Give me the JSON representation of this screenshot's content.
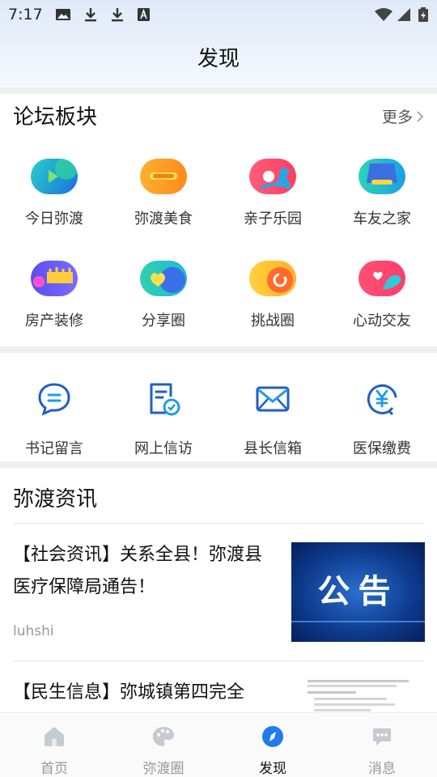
{
  "status": {
    "time": "7:17"
  },
  "header": {
    "title": "发现"
  },
  "forum": {
    "title": "论坛板块",
    "more": "更多",
    "items": [
      {
        "label": "今日弥渡",
        "icon": "play-video-icon"
      },
      {
        "label": "弥渡美食",
        "icon": "food-icon"
      },
      {
        "label": "亲子乐园",
        "icon": "rocking-horse-icon"
      },
      {
        "label": "车友之家",
        "icon": "car-icon"
      },
      {
        "label": "房产装修",
        "icon": "paint-brush-icon"
      },
      {
        "label": "分享圈",
        "icon": "heart-share-icon"
      },
      {
        "label": "挑战圈",
        "icon": "challenge-icon"
      },
      {
        "label": "心动交友",
        "icon": "bird-heart-icon"
      }
    ]
  },
  "services": {
    "items": [
      {
        "label": "书记留言",
        "icon": "chat-bubble-icon"
      },
      {
        "label": "网上信访",
        "icon": "document-check-icon"
      },
      {
        "label": "县长信箱",
        "icon": "mail-icon"
      },
      {
        "label": "医保缴费",
        "icon": "yuan-payment-icon"
      }
    ]
  },
  "news": {
    "title": "弥渡资讯",
    "items": [
      {
        "title": "【社会资讯】关系全县！弥渡县医疗保障局通告！",
        "source": "luhshi",
        "thumb_text": "公告"
      },
      {
        "title": "【民生信息】弥城镇第四完全",
        "source": ""
      }
    ]
  },
  "bottom_nav": {
    "items": [
      {
        "label": "首页",
        "icon": "home-icon",
        "active": false
      },
      {
        "label": "弥渡圈",
        "icon": "palette-icon",
        "active": false
      },
      {
        "label": "发现",
        "icon": "compass-icon",
        "active": true
      },
      {
        "label": "消息",
        "icon": "message-icon",
        "active": false
      }
    ]
  },
  "colors": {
    "accent": "#1f7ce8",
    "gap": "#efefef"
  }
}
